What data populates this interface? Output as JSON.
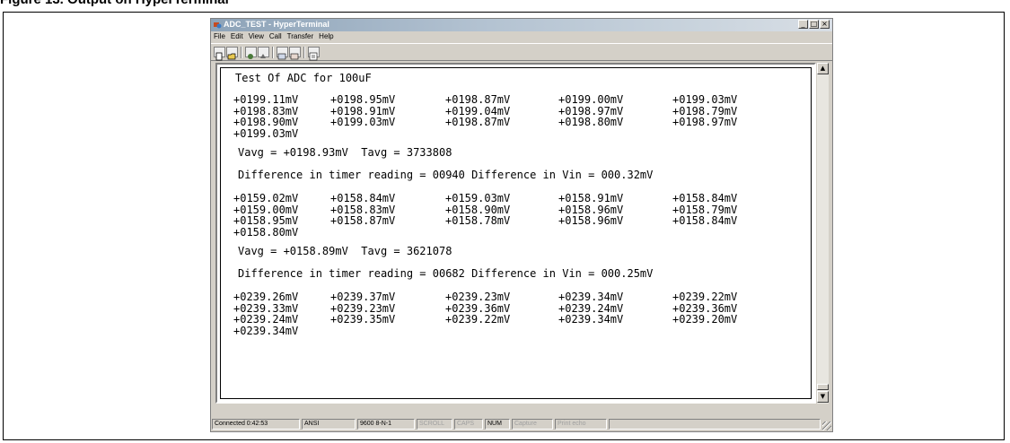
{
  "caption": "Figure 13.   Output on HyperTerminal",
  "window": {
    "title": "ADC_TEST - HyperTerminal",
    "controls": [
      "_",
      "□",
      "×"
    ]
  },
  "menu": [
    "File",
    "Edit",
    "View",
    "Call",
    "Transfer",
    "Help"
  ],
  "toolbar_icons": [
    "new-icon",
    "open-icon",
    "connect-icon",
    "disconnect-icon",
    "send-icon",
    "receive-icon",
    "properties-icon"
  ],
  "terminal": {
    "heading": "Test Of ADC for 100uF",
    "blocks": [
      {
        "rows": [
          [
            "+0199.11mV",
            "+0198.95mV",
            "+0198.87mV",
            "+0199.00mV",
            "+0199.03mV"
          ],
          [
            "+0198.83mV",
            "+0198.91mV",
            "+0199.04mV",
            "+0198.97mV",
            "+0198.79mV"
          ],
          [
            "+0198.90mV",
            "+0199.03mV",
            "+0198.87mV",
            "+0198.80mV",
            "+0198.97mV"
          ],
          [
            "+0199.03mV"
          ]
        ],
        "avg": "Vavg = +0198.93mV  Tavg = 3733808",
        "diff": "Difference in timer reading = 00940 Difference in Vin = 000.32mV"
      },
      {
        "rows": [
          [
            "+0159.02mV",
            "+0158.84mV",
            "+0159.03mV",
            "+0158.91mV",
            "+0158.84mV"
          ],
          [
            "+0159.00mV",
            "+0158.83mV",
            "+0158.90mV",
            "+0158.96mV",
            "+0158.79mV"
          ],
          [
            "+0158.95mV",
            "+0158.87mV",
            "+0158.78mV",
            "+0158.96mV",
            "+0158.84mV"
          ],
          [
            "+0158.80mV"
          ]
        ],
        "avg": "Vavg = +0158.89mV  Tavg = 3621078",
        "diff": "Difference in timer reading = 00682 Difference in Vin = 000.25mV"
      },
      {
        "rows": [
          [
            "+0239.26mV",
            "+0239.37mV",
            "+0239.23mV",
            "+0239.34mV",
            "+0239.22mV"
          ],
          [
            "+0239.33mV",
            "+0239.23mV",
            "+0239.36mV",
            "+0239.24mV",
            "+0239.36mV"
          ],
          [
            "+0239.24mV",
            "+0239.35mV",
            "+0239.22mV",
            "+0239.34mV",
            "+0239.20mV"
          ],
          [
            "+0239.34mV"
          ]
        ]
      }
    ]
  },
  "statusbar": {
    "connected": "Connected 0:42:53",
    "emulation": "ANSI",
    "settings": "9600 8-N-1",
    "scroll": "SCROLL",
    "caps": "CAPS",
    "num": "NUM",
    "capture": "Capture",
    "print_echo": "Print echo"
  }
}
